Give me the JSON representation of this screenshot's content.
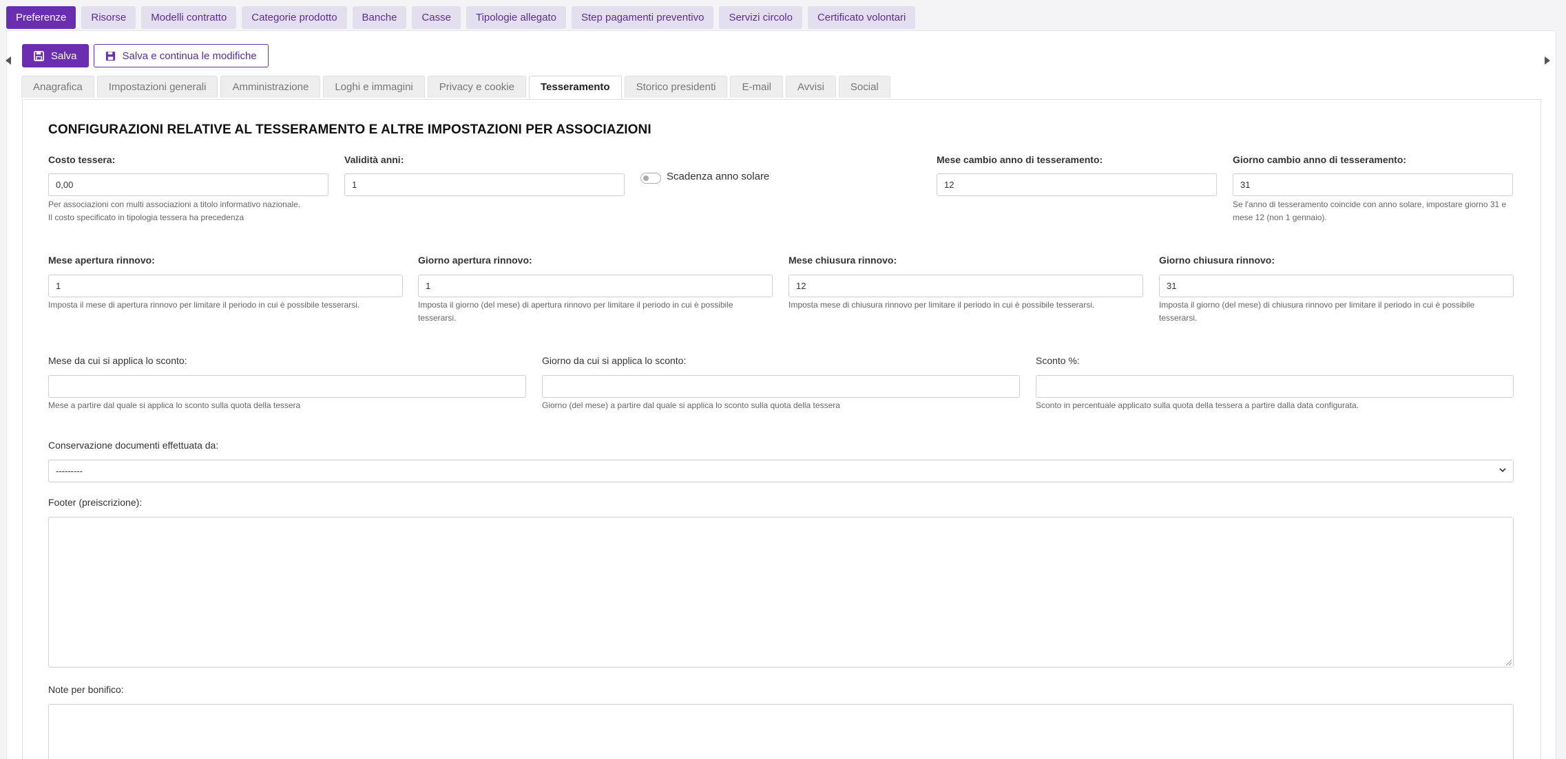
{
  "topnav": [
    {
      "label": "Preferenze",
      "active": true
    },
    {
      "label": "Risorse"
    },
    {
      "label": "Modelli contratto"
    },
    {
      "label": "Categorie prodotto"
    },
    {
      "label": "Banche"
    },
    {
      "label": "Casse"
    },
    {
      "label": "Tipologie allegato"
    },
    {
      "label": "Step pagamenti preventivo"
    },
    {
      "label": "Servizi circolo"
    },
    {
      "label": "Certificato volontari"
    }
  ],
  "actions": {
    "save_label": "Salva",
    "save_continue_label": "Salva e continua le modifiche"
  },
  "tabs": [
    {
      "label": "Anagrafica"
    },
    {
      "label": "Impostazioni generali"
    },
    {
      "label": "Amministrazione"
    },
    {
      "label": "Loghi e immagini"
    },
    {
      "label": "Privacy e cookie"
    },
    {
      "label": "Tesseramento",
      "active": true
    },
    {
      "label": "Storico presidenti"
    },
    {
      "label": "E-mail"
    },
    {
      "label": "Avvisi"
    },
    {
      "label": "Social"
    }
  ],
  "section_title": "CONFIGURAZIONI RELATIVE AL TESSERAMENTO E ALTRE IMPOSTAZIONI PER ASSOCIAZIONI",
  "row1": {
    "costo": {
      "label": "Costo tessera:",
      "value": "0,00",
      "help1": "Per associazioni con multi associazioni a titolo informativo nazionale.",
      "help2": "Il costo specificato in tipologia tessera ha precedenza"
    },
    "validita": {
      "label": "Validità anni:",
      "value": "1"
    },
    "scadenza": {
      "label": "Scadenza anno solare",
      "checked": false
    },
    "mese_cambio": {
      "label": "Mese cambio anno di tesseramento:",
      "value": "12"
    },
    "giorno_cambio": {
      "label": "Giorno cambio anno di tesseramento:",
      "value": "31",
      "help1": "Se l'anno di tesseramento coincide con anno solare, impostare giorno 31 e",
      "help2": "mese 12 (non 1 gennaio)."
    }
  },
  "row2": {
    "mese_apertura": {
      "label": "Mese apertura rinnovo:",
      "value": "1",
      "help": "Imposta il mese di apertura rinnovo per limitare il periodo in cui è possibile tesserarsi."
    },
    "giorno_apertura": {
      "label": "Giorno apertura rinnovo:",
      "value": "1",
      "help1": "Imposta il giorno (del mese) di apertura rinnovo per limitare il periodo in cui è possibile",
      "help2": "tesserarsi."
    },
    "mese_chiusura": {
      "label": "Mese chiusura rinnovo:",
      "value": "12",
      "help": "Imposta mese di chiusura rinnovo per limitare il periodo in cui è possibile tesserarsi."
    },
    "giorno_chiusura": {
      "label": "Giorno chiusura rinnovo:",
      "value": "31",
      "help1": "Imposta il giorno (del mese) di chiusura rinnovo per limitare il periodo in cui è possibile",
      "help2": "tesserarsi."
    }
  },
  "row3": {
    "mese_sconto": {
      "label": "Mese da cui si applica lo sconto:",
      "value": "",
      "help": "Mese a partire dal quale si applica lo sconto sulla quota della tessera"
    },
    "giorno_sconto": {
      "label": "Giorno da cui si applica lo sconto:",
      "value": "",
      "help": "Giorno (del mese) a partire dal quale si applica lo sconto sulla quota della tessera"
    },
    "sconto": {
      "label": "Sconto %:",
      "value": "",
      "help": "Sconto in percentuale applicato sulla quota della tessera a partire dalla data configurata."
    }
  },
  "conservazione": {
    "label": "Conservazione documenti effettuata da:",
    "value": "---------"
  },
  "footer": {
    "label": "Footer (preiscrizione):",
    "value": ""
  },
  "note": {
    "label": "Note per bonifico:",
    "value": ""
  },
  "colors": {
    "accent": "#6a2db0",
    "accent_light": "#e3dfee"
  }
}
